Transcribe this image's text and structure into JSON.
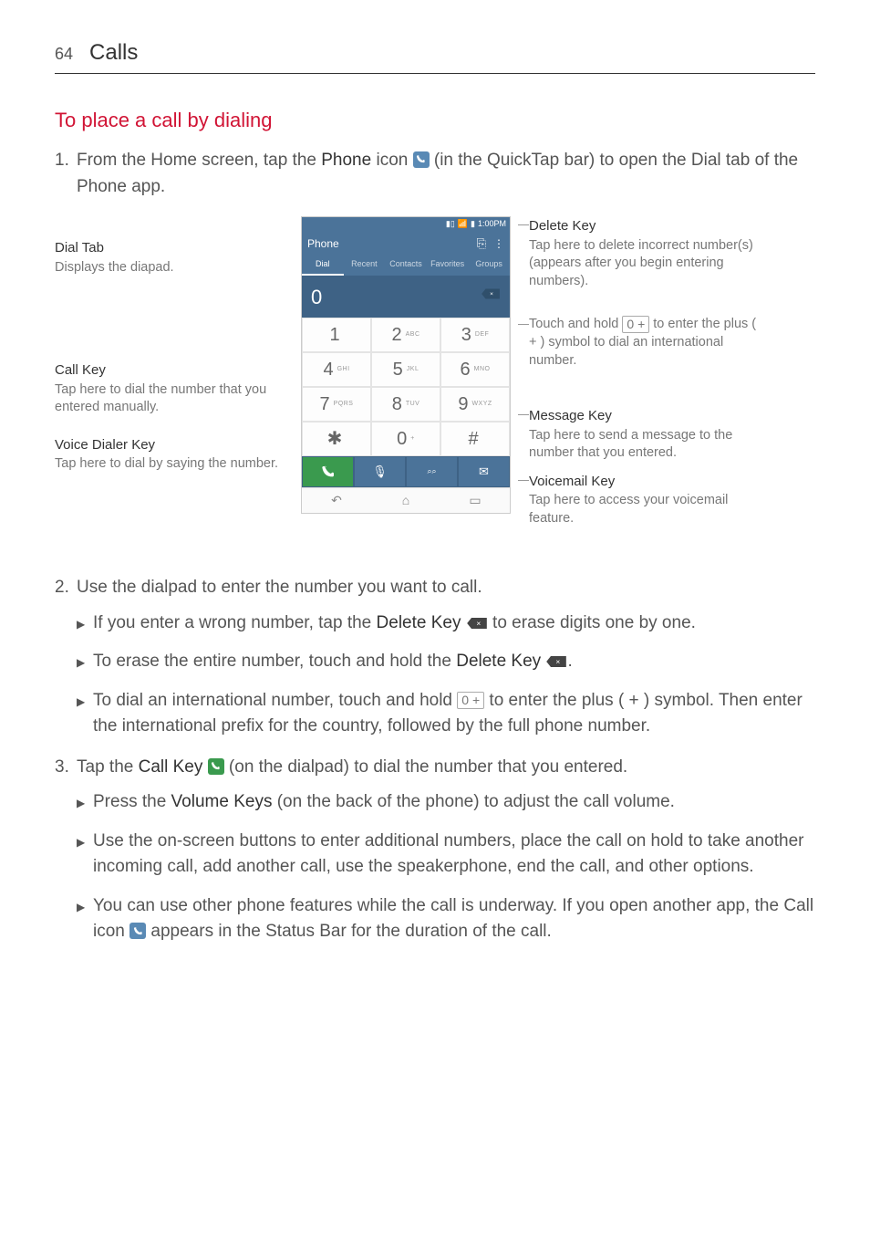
{
  "header": {
    "page_number": "64",
    "title": "Calls"
  },
  "section_title": "To place a call by dialing",
  "step1": {
    "num": "1.",
    "text_a": "From the Home screen, tap the ",
    "bold_phone": "Phone",
    "text_b": " icon ",
    "text_c": " (in the QuickTap bar) to open the Dial tab of the Phone app."
  },
  "diagram": {
    "left": {
      "dial_tab": {
        "title": "Dial Tab",
        "body": "Displays the diapad."
      },
      "call_key": {
        "title": "Call Key",
        "body": "Tap here to dial the number that you entered manually."
      },
      "voice_key": {
        "title": "Voice Dialer Key",
        "body": "Tap here to dial by saying the number."
      }
    },
    "right": {
      "delete_key": {
        "title": "Delete Key",
        "body": "Tap here to delete incorrect number(s) (appears after you begin entering numbers)."
      },
      "touch_hold": {
        "title_a": "Touch and hold ",
        "zero": "0 +",
        "title_b": " to enter the plus ( + ) symbol to dial an international number."
      },
      "message_key": {
        "title": "Message Key",
        "body": "Tap here to send a message to the number that you entered."
      },
      "voicemail_key": {
        "title": "Voicemail Key",
        "body": "Tap here to access your voicemail feature."
      }
    },
    "phone": {
      "status_time": "1:00PM",
      "title": "Phone",
      "tabs": [
        "Dial",
        "Recent",
        "Contacts",
        "Favorites",
        "Groups"
      ],
      "entry_num": "0",
      "keys": [
        {
          "d": "1",
          "l": ""
        },
        {
          "d": "2",
          "l": "ABC"
        },
        {
          "d": "3",
          "l": "DEF"
        },
        {
          "d": "4",
          "l": "GHI"
        },
        {
          "d": "5",
          "l": "JKL"
        },
        {
          "d": "6",
          "l": "MNO"
        },
        {
          "d": "7",
          "l": "PQRS"
        },
        {
          "d": "8",
          "l": "TUV"
        },
        {
          "d": "9",
          "l": "WXYZ"
        },
        {
          "d": "✱",
          "l": ""
        },
        {
          "d": "0",
          "l": "+"
        },
        {
          "d": "#",
          "l": ""
        }
      ]
    }
  },
  "step2": {
    "num": "2.",
    "text": "Use the dialpad to enter the number you want to call."
  },
  "step2_bullets": {
    "b1_a": "If you enter a wrong number, tap the ",
    "b1_bold": "Delete Key",
    "b1_b": " to erase digits one by one.",
    "b2_a": "To erase the entire number, touch and hold the ",
    "b2_bold": "Delete Key",
    "b2_b": ".",
    "b3_a": "To dial an international number, touch and hold ",
    "b3_zero": "0 +",
    "b3_b": " to enter the plus ( + ) symbol. Then enter the international prefix for the country, followed by the full phone number."
  },
  "step3": {
    "num": "3.",
    "a": "Tap the ",
    "bold": "Call Key",
    "b": " (on the dialpad) to dial the number that you entered."
  },
  "step3_bullets": {
    "b1_a": "Press the ",
    "b1_bold": "Volume Keys",
    "b1_b": " (on the back of the phone) to adjust the call volume.",
    "b2": "Use the on-screen buttons to enter additional numbers, place the call on hold to take another incoming call, add another call, use the speakerphone, end the call, and other options.",
    "b3_a": "You can use other phone features while the call is underway. If you open another app, the Call icon ",
    "b3_b": " appears in the Status Bar for the duration of the call."
  }
}
